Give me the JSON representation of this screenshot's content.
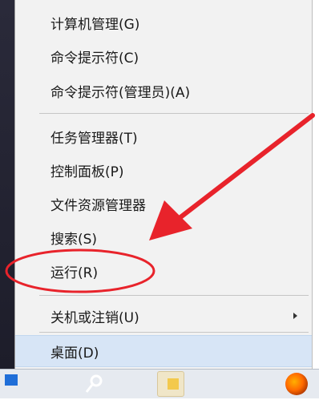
{
  "menu": {
    "items": [
      {
        "label": "计算机管理(G)"
      },
      {
        "label": "命令提示符(C)"
      },
      {
        "label": "命令提示符(管理员)(A)"
      },
      {
        "label": "任务管理器(T)"
      },
      {
        "label": "控制面板(P)"
      },
      {
        "label": "文件资源管理器"
      },
      {
        "label": "搜索(S)"
      },
      {
        "label": "运行(R)"
      },
      {
        "label": "关机或注销(U)"
      },
      {
        "label": "桌面(D)"
      }
    ]
  },
  "annotations": {
    "arrow_color": "#e8232b",
    "circle_color": "#e8232b"
  },
  "taskbar": {
    "icons": [
      "windows-start-icon",
      "search-icon",
      "file-explorer-icon",
      "firefox-icon"
    ]
  }
}
